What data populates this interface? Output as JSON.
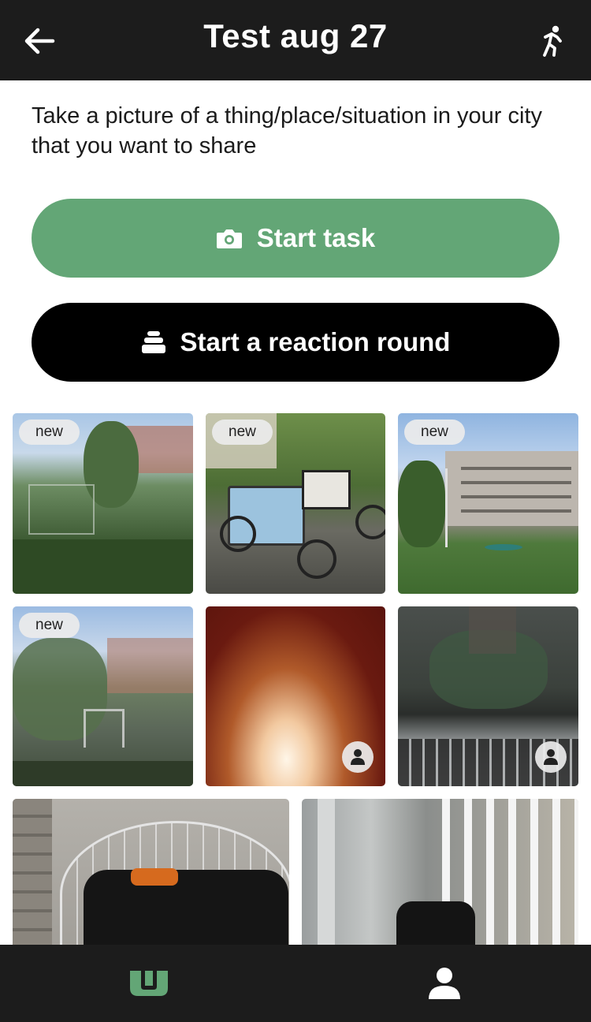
{
  "header": {
    "title": "Test aug 27",
    "back_icon": "arrow-left-icon",
    "activity_icon": "running-person-icon"
  },
  "task": {
    "description": "Take a picture of a thing/place/situation in your city that you want to share"
  },
  "actions": {
    "start_task_label": "Start task",
    "start_task_icon": "camera-icon",
    "reaction_round_label": "Start a reaction round",
    "reaction_round_icon": "stack-icon"
  },
  "colors": {
    "accent_green": "#63a676",
    "bar_dark": "#1c1c1c"
  },
  "photos": [
    {
      "badge": "new",
      "content": "garden with trees and buildings"
    },
    {
      "badge": "new",
      "content": "cargo bike in courtyard"
    },
    {
      "badge": "new",
      "content": "apartment block with lawn"
    },
    {
      "badge": "new",
      "content": "fenced sports court"
    },
    {
      "badge": "",
      "content": "dark red blurred photo",
      "user_icon": "person-icon"
    },
    {
      "badge": "",
      "content": "laptop reflection",
      "user_icon": "person-icon"
    },
    {
      "badge": "",
      "content": "wire basket with bags"
    },
    {
      "badge": "",
      "content": "gate with bags"
    }
  ],
  "bottom_nav": {
    "home_icon": "u-logo-icon",
    "profile_icon": "person-icon"
  }
}
